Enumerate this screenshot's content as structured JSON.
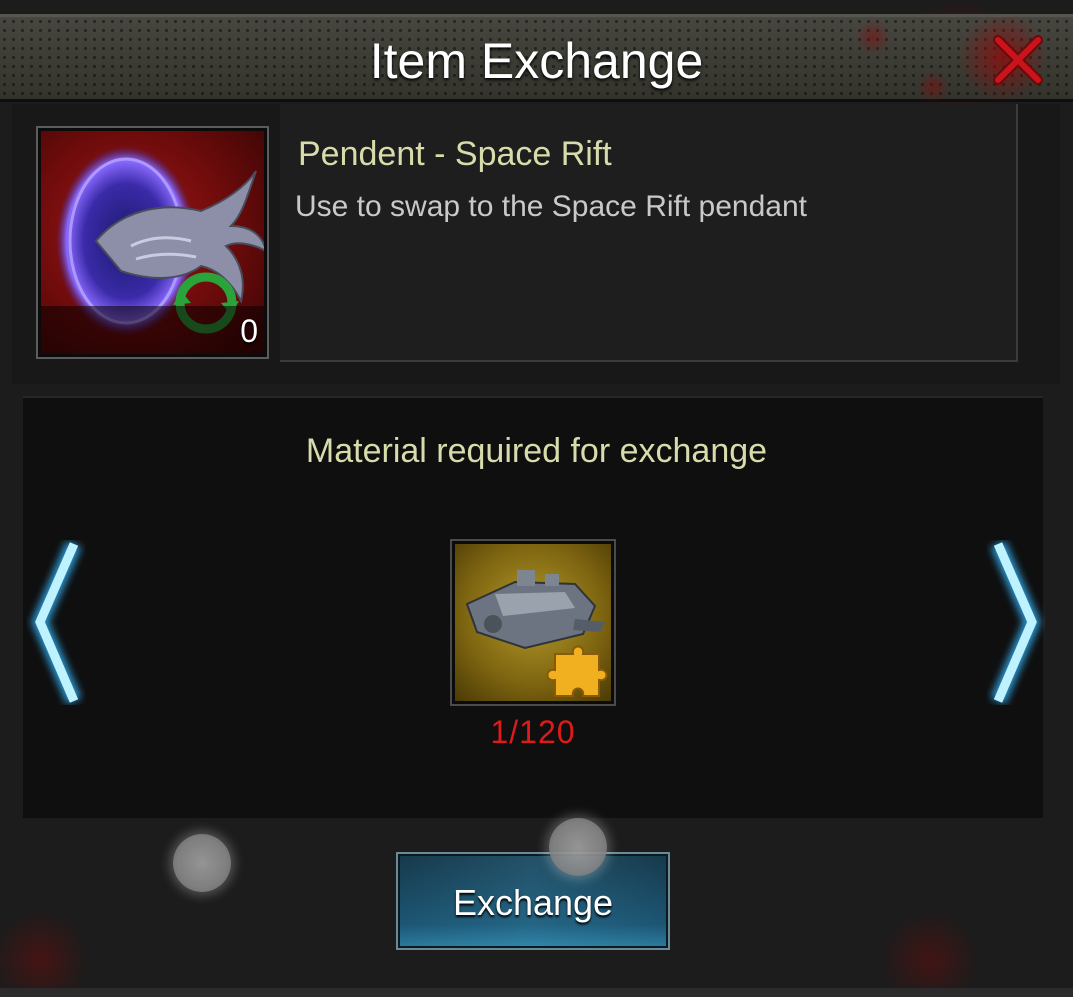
{
  "dialog": {
    "title": "Item Exchange",
    "close_icon": "close-x-icon"
  },
  "item": {
    "name": "Pendent - Space Rift",
    "description": "Use to swap to the Space Rift pendant",
    "count": "0",
    "icon": "space-rift-pendant-icon",
    "badge_icon": "swap-cycle-icon"
  },
  "material": {
    "header": "Material required for exchange",
    "icon": "warship-fragment-icon",
    "progress": "1/120",
    "owned": 1,
    "required": 120
  },
  "navigation": {
    "prev_icon": "chevron-left-icon",
    "next_icon": "chevron-right-icon"
  },
  "actions": {
    "exchange_label": "Exchange"
  },
  "colors": {
    "title_text": "#ffffff",
    "item_name": "#d8dcab",
    "description_text": "#c9c9c9",
    "shortfall_count": "#e01a1a",
    "arrow_glow": "#8ee6ff",
    "close_red": "#c8141a"
  }
}
